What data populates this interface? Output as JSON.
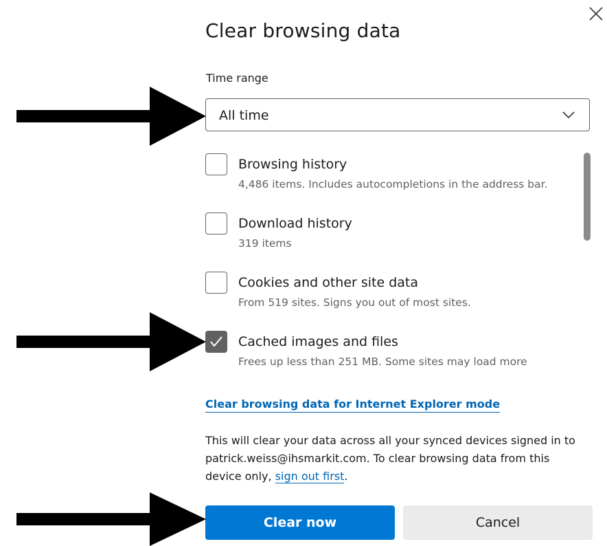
{
  "dialog": {
    "title": "Clear browsing data",
    "close_icon": "close-icon"
  },
  "time_range": {
    "label": "Time range",
    "selected": "All time",
    "chevron_icon": "chevron-down-icon"
  },
  "items": [
    {
      "title": "Browsing history",
      "description": "4,486 items. Includes autocompletions in the address bar.",
      "checked": false
    },
    {
      "title": "Download history",
      "description": "319 items",
      "checked": false
    },
    {
      "title": "Cookies and other site data",
      "description": "From 519 sites. Signs you out of most sites.",
      "checked": false
    },
    {
      "title": "Cached images and files",
      "description": "Frees up less than 251 MB. Some sites may load more",
      "checked": true
    }
  ],
  "ie_link": "Clear browsing data for Internet Explorer mode",
  "info": {
    "line1": "This will clear your data across all your synced devices signed in to",
    "line2": "patrick.weiss@ihsmarkit.com. To clear browsing data from this",
    "line3_prefix": "device only, ",
    "sign_out_link": "sign out first",
    "line3_suffix": "."
  },
  "buttons": {
    "clear_now": "Clear now",
    "cancel": "Cancel"
  },
  "colors": {
    "accent": "#0078d4",
    "link": "#0066b4",
    "checkbox_checked": "#616161"
  }
}
